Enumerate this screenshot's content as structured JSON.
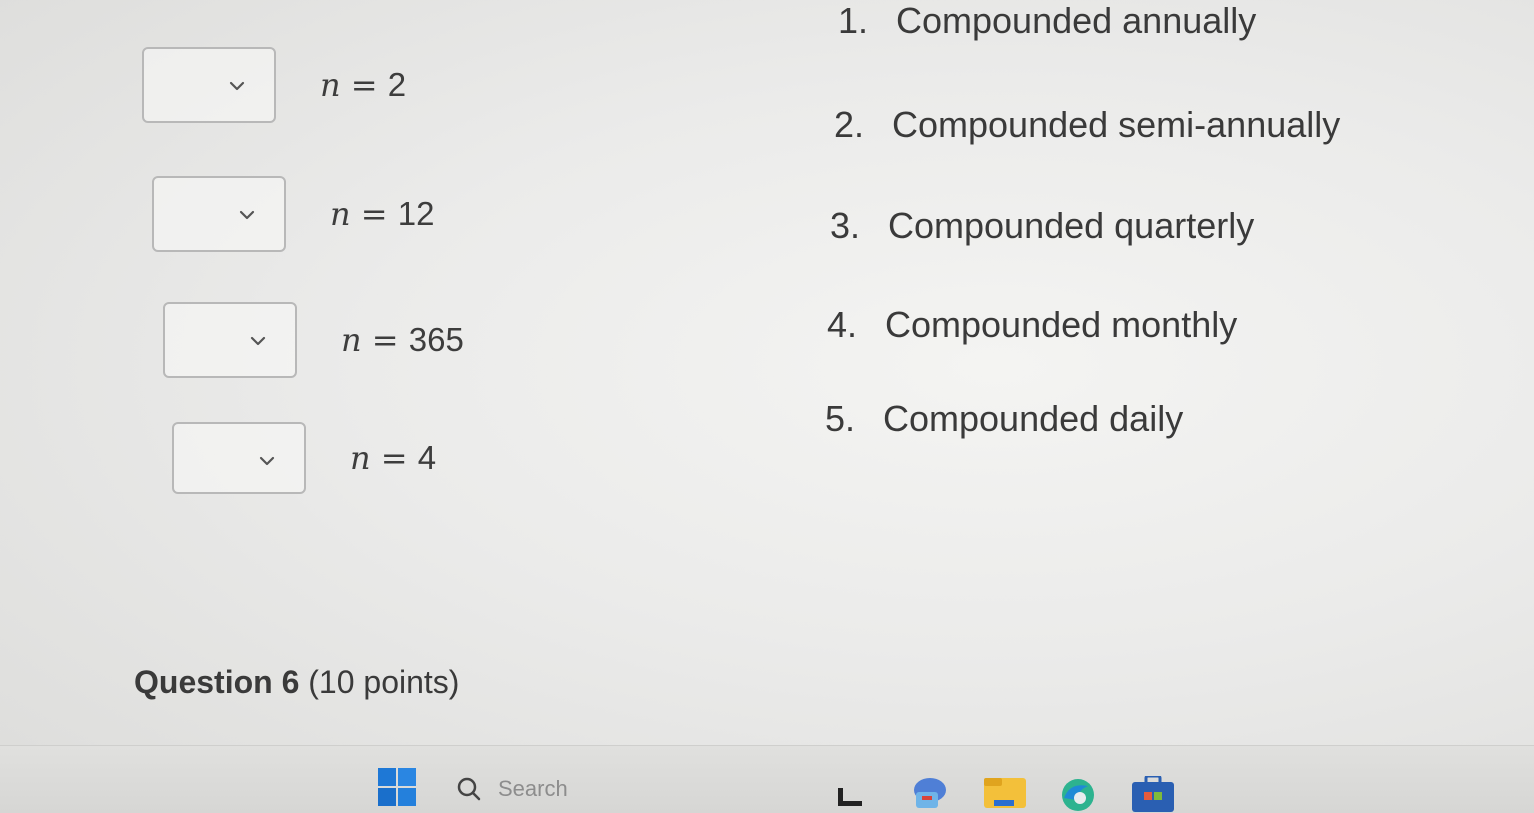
{
  "matching": {
    "rows": [
      {
        "selected": "",
        "var": "n",
        "eq": " = ",
        "value": "2"
      },
      {
        "selected": "",
        "var": "n",
        "eq": " = ",
        "value": "12"
      },
      {
        "selected": "",
        "var": "n",
        "eq": " = ",
        "value": "365"
      },
      {
        "selected": "",
        "var": "n",
        "eq": " = ",
        "value": "4"
      }
    ],
    "options": [
      {
        "index": "1.",
        "label": "Compounded annually"
      },
      {
        "index": "2.",
        "label": "Compounded semi-annually"
      },
      {
        "index": "3.",
        "label": "Compounded quarterly"
      },
      {
        "index": "4.",
        "label": "Compounded monthly"
      },
      {
        "index": "5.",
        "label": "Compounded daily"
      }
    ]
  },
  "question": {
    "title": "Question 6",
    "points": "(10 points)"
  },
  "taskbar": {
    "search_placeholder": "Search",
    "icons": [
      "windows-start-icon",
      "search-icon",
      "widget-icon",
      "teams-icon",
      "file-explorer-icon",
      "edge-icon",
      "store-icon"
    ]
  },
  "colors": {
    "page_bg": "#ebebea",
    "text": "#3a3a3a",
    "box_border": "#b8b8b8",
    "start_blue": "#1e78d6"
  }
}
